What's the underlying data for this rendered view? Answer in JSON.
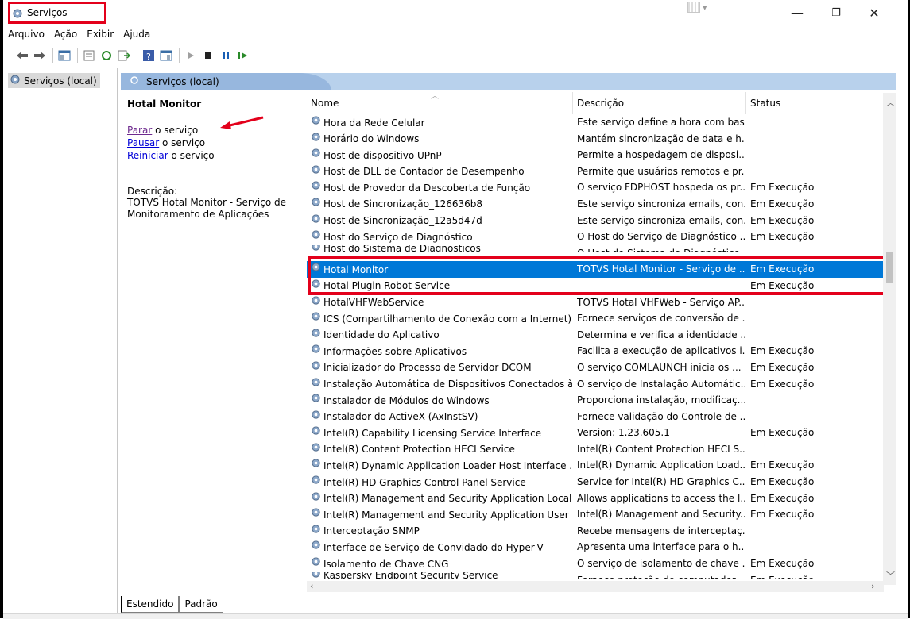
{
  "window": {
    "title": "Serviços",
    "min": "—",
    "max": "❐",
    "close": "✕"
  },
  "menu": [
    "Arquivo",
    "Ação",
    "Exibir",
    "Ajuda"
  ],
  "tree": {
    "item": "Serviços (local)"
  },
  "header": {
    "title": "Serviços (local)"
  },
  "detail": {
    "service_name": "Hotal Monitor",
    "stop_link": "Parar",
    "pause_link": "Pausar",
    "restart_link": "Reiniciar",
    "link_suffix": " o serviço",
    "description_label": "Descrição:",
    "description": "TOTVS Hotal Monitor - Serviço de Monitoramento de Aplicações"
  },
  "columns": {
    "name": "Nome",
    "description": "Descrição",
    "status": "Status"
  },
  "rows": [
    {
      "name": "Hora da Rede Celular",
      "desc": "Este serviço define a hora com bas...",
      "status": ""
    },
    {
      "name": "Horário do Windows",
      "desc": "Mantém sincronização de data e h...",
      "status": ""
    },
    {
      "name": "Host de dispositivo UPnP",
      "desc": "Permite a hospedagem de disposi...",
      "status": ""
    },
    {
      "name": "Host de DLL de Contador de Desempenho",
      "desc": "Permite que usuários remotos e pr...",
      "status": ""
    },
    {
      "name": "Host de Provedor da Descoberta de Função",
      "desc": "O serviço FDPHOST hospeda os pr...",
      "status": "Em Execução"
    },
    {
      "name": "Host de Sincronização_126636b8",
      "desc": "Este serviço sincroniza emails, con...",
      "status": "Em Execução"
    },
    {
      "name": "Host de Sincronização_12a5d47d",
      "desc": "Este serviço sincroniza emails, con...",
      "status": "Em Execução"
    },
    {
      "name": "Host do Serviço de Diagnóstico",
      "desc": "O Host do Serviço de Diagnóstico ...",
      "status": "Em Execução"
    },
    {
      "name": "Host do Sistema de Diagnósticos",
      "desc": "O Host do Sistema de Diagnóstico...",
      "status": ""
    },
    {
      "name": "Hotal Monitor",
      "desc": "TOTVS Hotal Monitor - Serviço de ...",
      "status": "Em Execução"
    },
    {
      "name": "Hotal Plugin Robot Service",
      "desc": "",
      "status": "Em Execução"
    },
    {
      "name": "HotalVHFWebService",
      "desc": "TOTVS Hotal VHFWeb - Serviço AP...",
      "status": ""
    },
    {
      "name": "ICS (Compartilhamento de Conexão com a Internet)",
      "desc": "Fornece serviços de conversão de ...",
      "status": ""
    },
    {
      "name": "Identidade do Aplicativo",
      "desc": "Determina e verifica a identidade ...",
      "status": ""
    },
    {
      "name": "Informações sobre Aplicativos",
      "desc": "Facilita a execução de aplicativos i...",
      "status": "Em Execução"
    },
    {
      "name": "Inicializador do Processo de Servidor DCOM",
      "desc": "O serviço COMLAUNCH inicia os ...",
      "status": "Em Execução"
    },
    {
      "name": "Instalação Automática de Dispositivos Conectados à...",
      "desc": "O serviço de Instalação Automátic...",
      "status": "Em Execução"
    },
    {
      "name": "Instalador de Módulos do Windows",
      "desc": "Proporciona instalação, modificaç...",
      "status": ""
    },
    {
      "name": "Instalador do ActiveX (AxInstSV)",
      "desc": "Fornece validação do Controle de ...",
      "status": ""
    },
    {
      "name": "Intel(R) Capability Licensing Service Interface",
      "desc": "Version: 1.23.605.1",
      "status": "Em Execução"
    },
    {
      "name": "Intel(R) Content Protection HECI Service",
      "desc": "Intel(R) Content Protection HECI S...",
      "status": ""
    },
    {
      "name": "Intel(R) Dynamic Application Loader Host Interface ...",
      "desc": "Intel(R) Dynamic Application Load...",
      "status": "Em Execução"
    },
    {
      "name": "Intel(R) HD Graphics Control Panel Service",
      "desc": "Service for Intel(R) HD Graphics C...",
      "status": "Em Execução"
    },
    {
      "name": "Intel(R) Management and Security Application Local...",
      "desc": "Allows applications to access the l...",
      "status": "Em Execução"
    },
    {
      "name": "Intel(R) Management and Security Application User ...",
      "desc": "Intel(R) Management and Security...",
      "status": "Em Execução"
    },
    {
      "name": "Interceptação SNMP",
      "desc": "Recebe mensagens de interceptaç...",
      "status": ""
    },
    {
      "name": "Interface de Serviço de Convidado do Hyper-V",
      "desc": "Apresenta uma interface para o h...",
      "status": ""
    },
    {
      "name": "Isolamento de Chave CNG",
      "desc": "O serviço de isolamento de chave ...",
      "status": "Em Execução"
    },
    {
      "name": "Kaspersky Endpoint Security Service",
      "desc": "Fornece proteção do computador...",
      "status": "Em Execução"
    }
  ],
  "tabs": [
    "Estendido",
    "Padrão"
  ],
  "colors": {
    "selection": "#0078d7",
    "highlight_box": "#e3001b",
    "header": "#97b7de"
  }
}
